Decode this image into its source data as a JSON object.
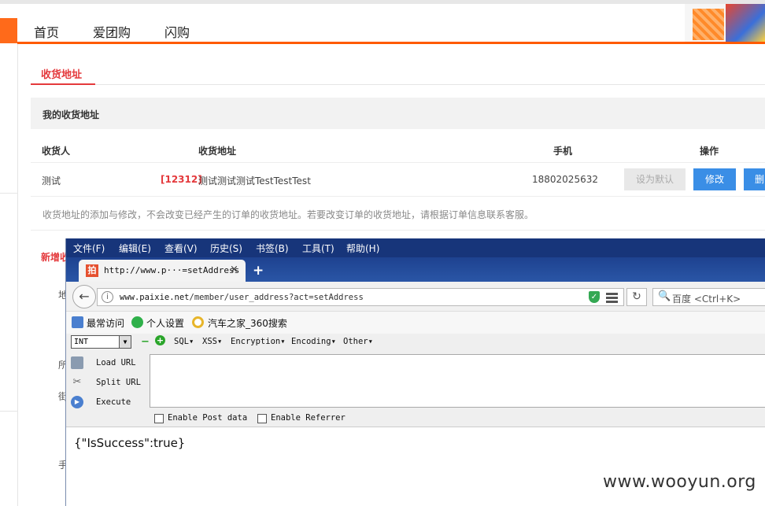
{
  "shop": {
    "nav": [
      "首页",
      "爱团购",
      "闪购"
    ],
    "section_title": "收货地址",
    "my_address_heading": "我的收货地址",
    "columns": {
      "receiver": "收货人",
      "address": "收货地址",
      "phone": "手机",
      "actions": "操作"
    },
    "row": {
      "receiver": "测试",
      "zip": "[12312]",
      "address": "测试测试测试TestTestTest",
      "phone": "18802025632",
      "set_default": "设为默认",
      "edit": "修改",
      "delete": "删"
    },
    "note": "收货地址的添加与修改，不会改变已经产生的订单的收货地址。若要改变订单的收货地址，请根据订单信息联系客服。",
    "new_address": "新增收",
    "side_chars": [
      "地",
      "所",
      "街",
      "手"
    ]
  },
  "firefox": {
    "menu": [
      "文件(F)",
      "编辑(E)",
      "查看(V)",
      "历史(S)",
      "书签(B)",
      "工具(T)",
      "帮助(H)"
    ],
    "tab": {
      "favicon": "拍",
      "title": "http://www.p···=setAddress",
      "close": "×"
    },
    "newtab": "+",
    "url": {
      "domain": "www.paixie.net",
      "path": "/member/user_address?act=setAddress"
    },
    "search_placeholder": "百度 <Ctrl+K>",
    "bookmarks": [
      "最常访问",
      "个人设置",
      "汽车之家_360搜索"
    ],
    "hackbar": {
      "select_value": "INT",
      "menus": [
        "SQL▾",
        "XSS▾",
        "Encryption▾",
        "Encoding▾",
        "Other▾"
      ],
      "actions": [
        "Load URL",
        "Split URL",
        "Execute"
      ],
      "enable_post": "Enable Post data",
      "enable_referrer": "Enable Referrer"
    },
    "response": "{\"IsSuccess\":true}"
  },
  "watermark": "www.wooyun.org",
  "colors": {
    "accent_orange": "#ff5a00",
    "accent_red": "#e4393c",
    "button_blue": "#3a8ee6",
    "firefox_blue": "#17357a"
  }
}
